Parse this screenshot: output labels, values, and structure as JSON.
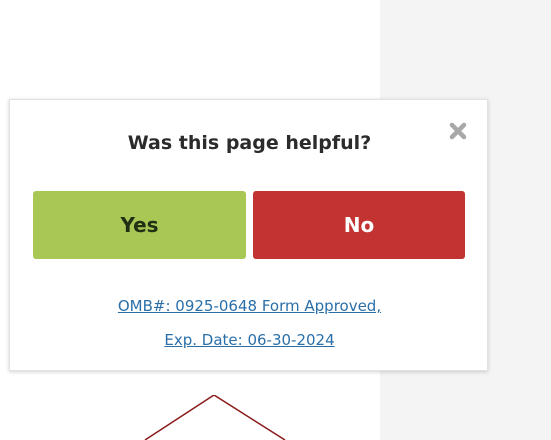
{
  "feedback_popup": {
    "title": "Was this page helpful?",
    "close_icon": "close-icon",
    "yes_label": "Yes",
    "no_label": "No",
    "omb_line1": "OMB#: 0925-0648 Form Approved,",
    "omb_line2": "Exp. Date: 06-30-2024"
  },
  "colors": {
    "yes_bg": "#a8c755",
    "no_bg": "#c23332",
    "link": "#2a6fa8",
    "pointer_stroke": "#8b1a1a"
  }
}
